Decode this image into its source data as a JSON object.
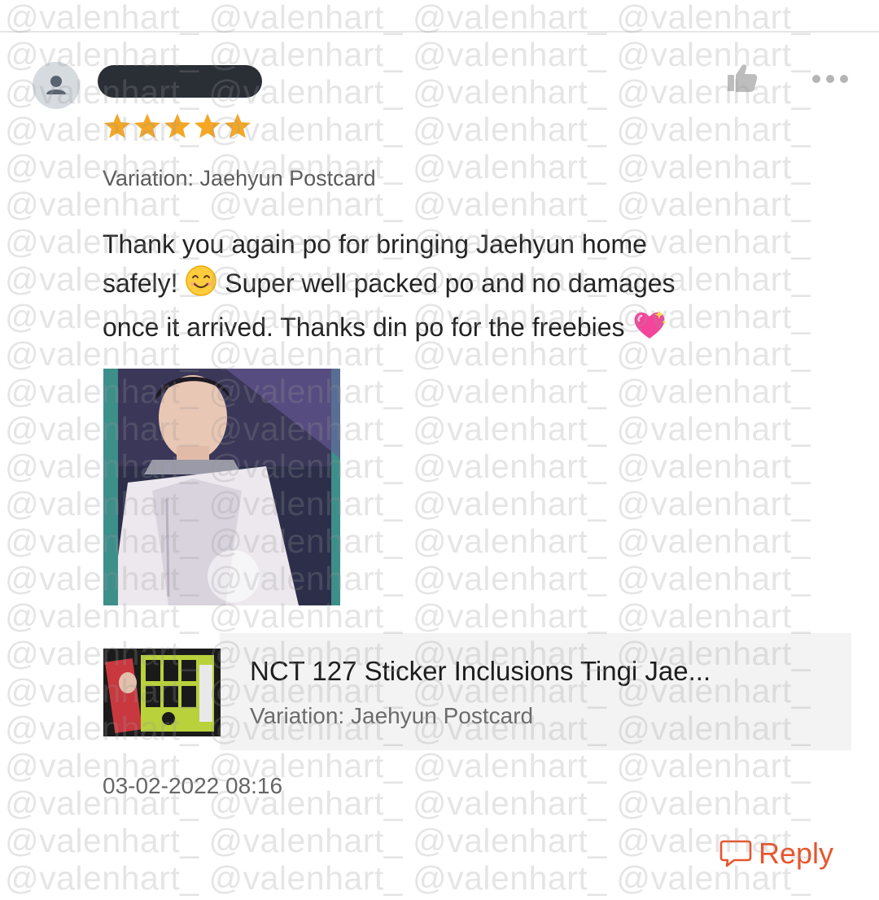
{
  "review": {
    "rating": 5,
    "variation_label": "Variation: Jaehyun Postcard",
    "text_line1": "Thank you again po for bringing Jaehyun home",
    "text_line2a": "safely!",
    "text_line2b": "Super well packed po and no damages",
    "text_line3": "once it arrived. Thanks din po for the freebies",
    "timestamp": "03-02-2022 08:16",
    "reply_label": "Reply"
  },
  "product": {
    "name": "NCT 127 Sticker Inclusions Tingi Jae...",
    "variation": "Variation: Jaehyun Postcard"
  },
  "icons": {
    "avatar": "user-avatar-icon",
    "like": "thumbs-up-icon",
    "more": "more-options-icon",
    "star": "star-icon",
    "reply": "chat-bubble-icon"
  },
  "colors": {
    "star": "#f5a623",
    "reply": "#e8552d",
    "redaction": "#2a2f36",
    "card_bg": "#f3f3f3"
  },
  "watermark": {
    "text": "@valenhart_ @valenhart_ @valenhart_ @valenhart_"
  }
}
